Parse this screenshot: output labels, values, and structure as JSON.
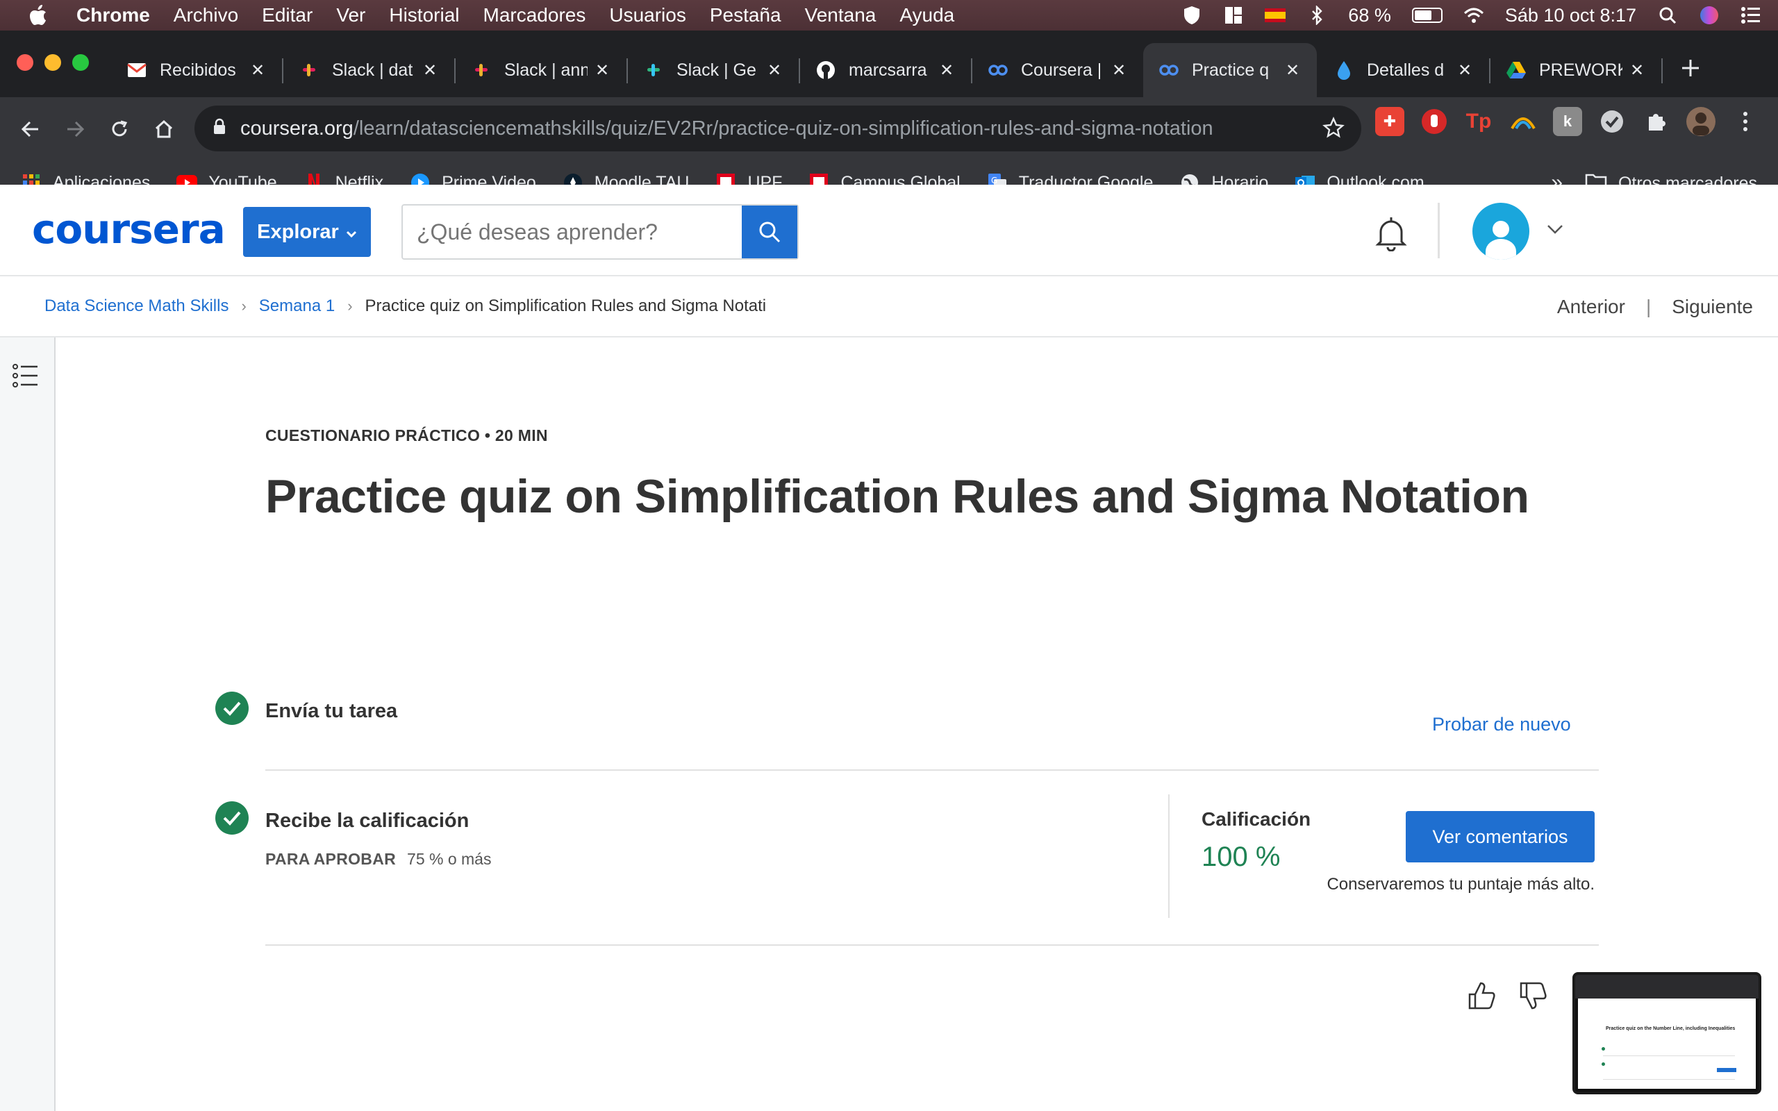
{
  "menubar": {
    "app": "Chrome",
    "items": [
      "Archivo",
      "Editar",
      "Ver",
      "Historial",
      "Marcadores",
      "Usuarios",
      "Pestaña",
      "Ventana",
      "Ayuda"
    ],
    "battery": "68 %",
    "battery_level": 0.68,
    "datetime": "Sáb 10 oct  8:17"
  },
  "tabs": [
    {
      "title": "Recibidos",
      "icon": "gmail-icon",
      "color": "#ea4335"
    },
    {
      "title": "Slack | dat",
      "icon": "slack-icon",
      "color": "#e01e5a"
    },
    {
      "title": "Slack | ann",
      "icon": "slack-icon",
      "color": "#e01e5a"
    },
    {
      "title": "Slack | Ge",
      "icon": "slack-icon",
      "color": "#2eb67d"
    },
    {
      "title": "marcsarra",
      "icon": "github-icon",
      "color": "#ffffff"
    },
    {
      "title": "Coursera |",
      "icon": "coursera-icon",
      "color": "#4d8ff0"
    },
    {
      "title": "Practice q",
      "icon": "coursera-icon",
      "color": "#4d8ff0",
      "active": true
    },
    {
      "title": "Detalles d",
      "icon": "drop-icon",
      "color": "#3aa0f0"
    },
    {
      "title": "PREWORK",
      "icon": "drive-icon",
      "color": "#fbbc04"
    }
  ],
  "address": {
    "host": "coursera.org",
    "path": "/learn/datasciencemathskills/quiz/EV2Rr/practice-quiz-on-simplification-rules-and-sigma-notation"
  },
  "bookmarks": [
    {
      "label": "Aplicaciones",
      "icon": "apps-grid-icon",
      "color": "#ea4335"
    },
    {
      "label": "YouTube",
      "icon": "youtube-icon",
      "color": "#ff0000"
    },
    {
      "label": "Netflix",
      "icon": "netflix-icon",
      "color": "#e50914"
    },
    {
      "label": "Prime Video",
      "icon": "prime-video-icon",
      "color": "#1a98ff"
    },
    {
      "label": "Moodle TAU",
      "icon": "moodle-icon",
      "color": "#0b3c5d"
    },
    {
      "label": "UPF",
      "icon": "upf-icon",
      "color": "#e0001b"
    },
    {
      "label": "Campus Global",
      "icon": "campus-icon",
      "color": "#e0001b"
    },
    {
      "label": "Traductor Google",
      "icon": "translate-icon",
      "color": "#4285f4"
    },
    {
      "label": "Horario",
      "icon": "globe-icon",
      "color": "#ffffff"
    },
    {
      "label": "Outlook.com",
      "icon": "outlook-icon",
      "color": "#0078d4"
    }
  ],
  "bookmarks_more": "»",
  "bookmarks_other": "Otros marcadores",
  "header": {
    "logo": "coursera",
    "explore": "Explorar",
    "search_placeholder": "¿Qué deseas aprender?"
  },
  "breadcrumb": {
    "items": [
      "Data Science Math Skills",
      "Semana 1"
    ],
    "current": "Practice quiz on Simplification Rules and Sigma Notati",
    "prev": "Anterior",
    "next": "Siguiente"
  },
  "quiz": {
    "kicker": "CUESTIONARIO PRÁCTICO • 20 MIN",
    "title": "Practice quiz on Simplification Rules and Sigma Notation",
    "step1": "Envía tu tarea",
    "retry": "Probar de nuevo",
    "step2": "Recibe la calificación",
    "pass_label": "PARA APROBAR",
    "pass_value": "75 % o más",
    "grade_label": "Calificación",
    "grade_value": "100 %",
    "view_feedback": "Ver comentarios",
    "keep_note": "Conservaremos tu puntaje más alto."
  },
  "preview": {
    "title": "Practice quiz on the Number Line, including Inequalities"
  },
  "colors": {
    "accent": "#1f6fd0",
    "success": "#1f8354",
    "brand": "#0056d2"
  }
}
